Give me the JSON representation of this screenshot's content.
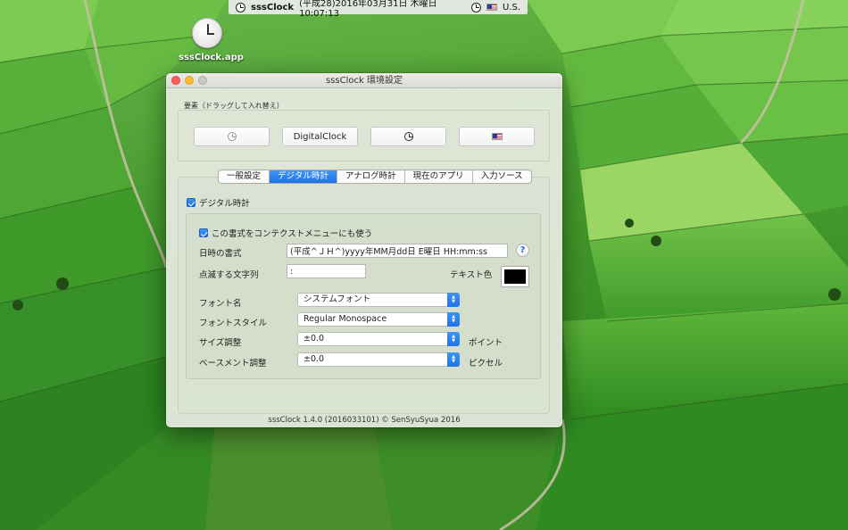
{
  "menubar": {
    "app_name": "sssClock",
    "datetime": "(平成28)2016年03月31日 木曜日 10:07:13",
    "input_source": "U.S."
  },
  "desktop": {
    "icon_label": "sssClock.app"
  },
  "window": {
    "title": "sssClock 環境設定",
    "elements_label": "要素（ドラッグして入れ替え）",
    "element_buttons": [
      "DigitalClock"
    ],
    "tabs": [
      "一般設定",
      "デジタル時計",
      "アナログ時計",
      "現在のアプリ",
      "入力ソース"
    ],
    "active_tab": "デジタル時計",
    "digital": {
      "enable_label": "デジタル時計",
      "context_menu_label": "この書式をコンテクストメニューにも使う",
      "format_label": "日時の書式",
      "format_value": "(平成^ＪＨ^)yyyy年MM月dd日 E曜日 HH:mm:ss",
      "help": "?",
      "blink_label": "点滅する文字列",
      "blink_value": ":",
      "text_color_label": "テキスト色",
      "text_color": "#000000",
      "font_name_label": "フォント名",
      "font_name_value": "システムフォント",
      "font_style_label": "フォントスタイル",
      "font_style_value": "Regular Monospace",
      "size_label": "サイズ調整",
      "size_value": "±0.0",
      "size_unit": "ポイント",
      "baseline_label": "ベースメント調整",
      "baseline_value": "±0.0",
      "baseline_unit": "ピクセル"
    },
    "footer": "sssClock 1.4.0 (2016033101) © SenSyuSyua 2016"
  },
  "icons": [
    "clock-icon",
    "us-flag-icon",
    "checkbox-icon",
    "help-icon",
    "stepper-arrows-icon"
  ]
}
